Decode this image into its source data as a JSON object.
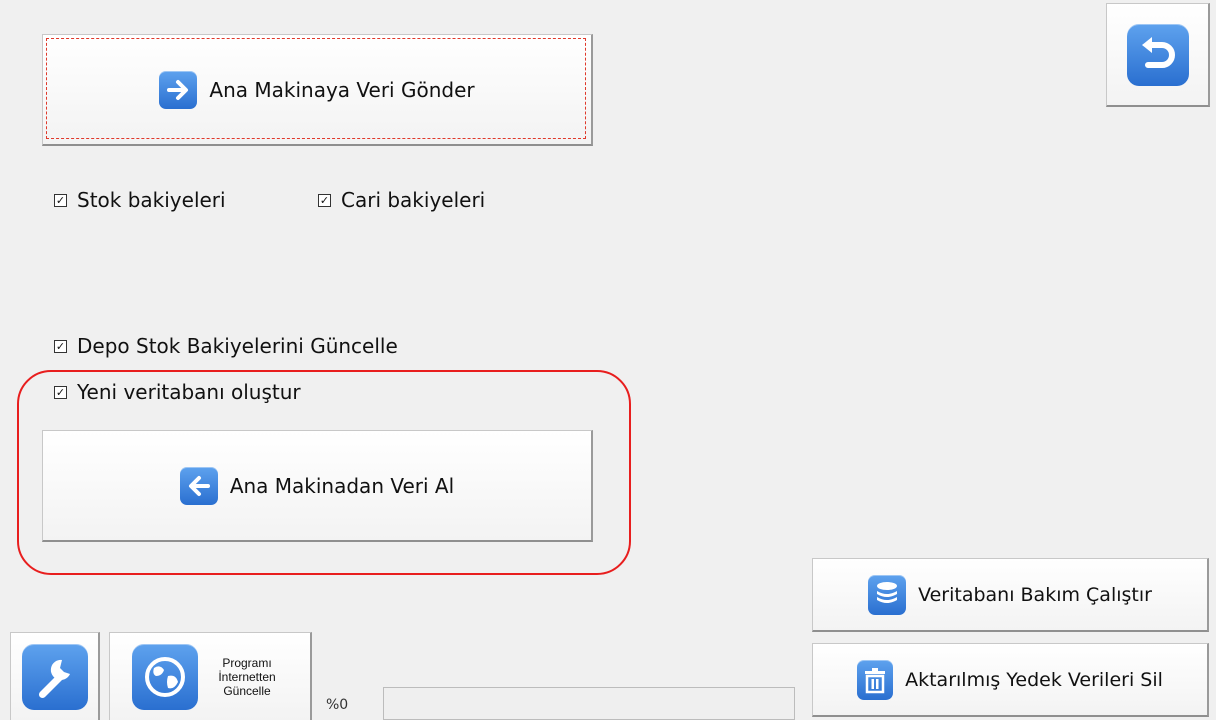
{
  "send": {
    "label": "Ana Makinaya Veri Gönder",
    "icon": "arrow-right-icon"
  },
  "receive": {
    "label": "Ana Makinadan Veri Al",
    "icon": "arrow-left-icon"
  },
  "checkboxes": {
    "stock_balances": {
      "label": "Stok bakiyeleri",
      "checked": true
    },
    "account_balances": {
      "label": "Cari bakiyeleri",
      "checked": true
    },
    "warehouse_update": {
      "label": "Depo Stok Bakiyelerini Güncelle",
      "checked": true
    },
    "new_database": {
      "label": "Yeni veritabanı oluştur",
      "checked": true
    }
  },
  "maintenance": {
    "label": "Veritabanı Bakım Çalıştır",
    "icon": "database-icon"
  },
  "delete_backup": {
    "label": "Aktarılmış Yedek Verileri Sil",
    "icon": "trash-icon"
  },
  "update": {
    "line1": "Programı",
    "line2": "İnternetten",
    "line3": "Güncelle",
    "icon": "globe-icon"
  },
  "tools": {
    "icon": "wrench-icon"
  },
  "back": {
    "icon": "undo-arrow-icon"
  },
  "progress": {
    "label": "%0",
    "value": 0
  },
  "colors": {
    "accent": "#2a6fd0",
    "highlight": "#e81e1e",
    "background": "#f0f0f0"
  }
}
